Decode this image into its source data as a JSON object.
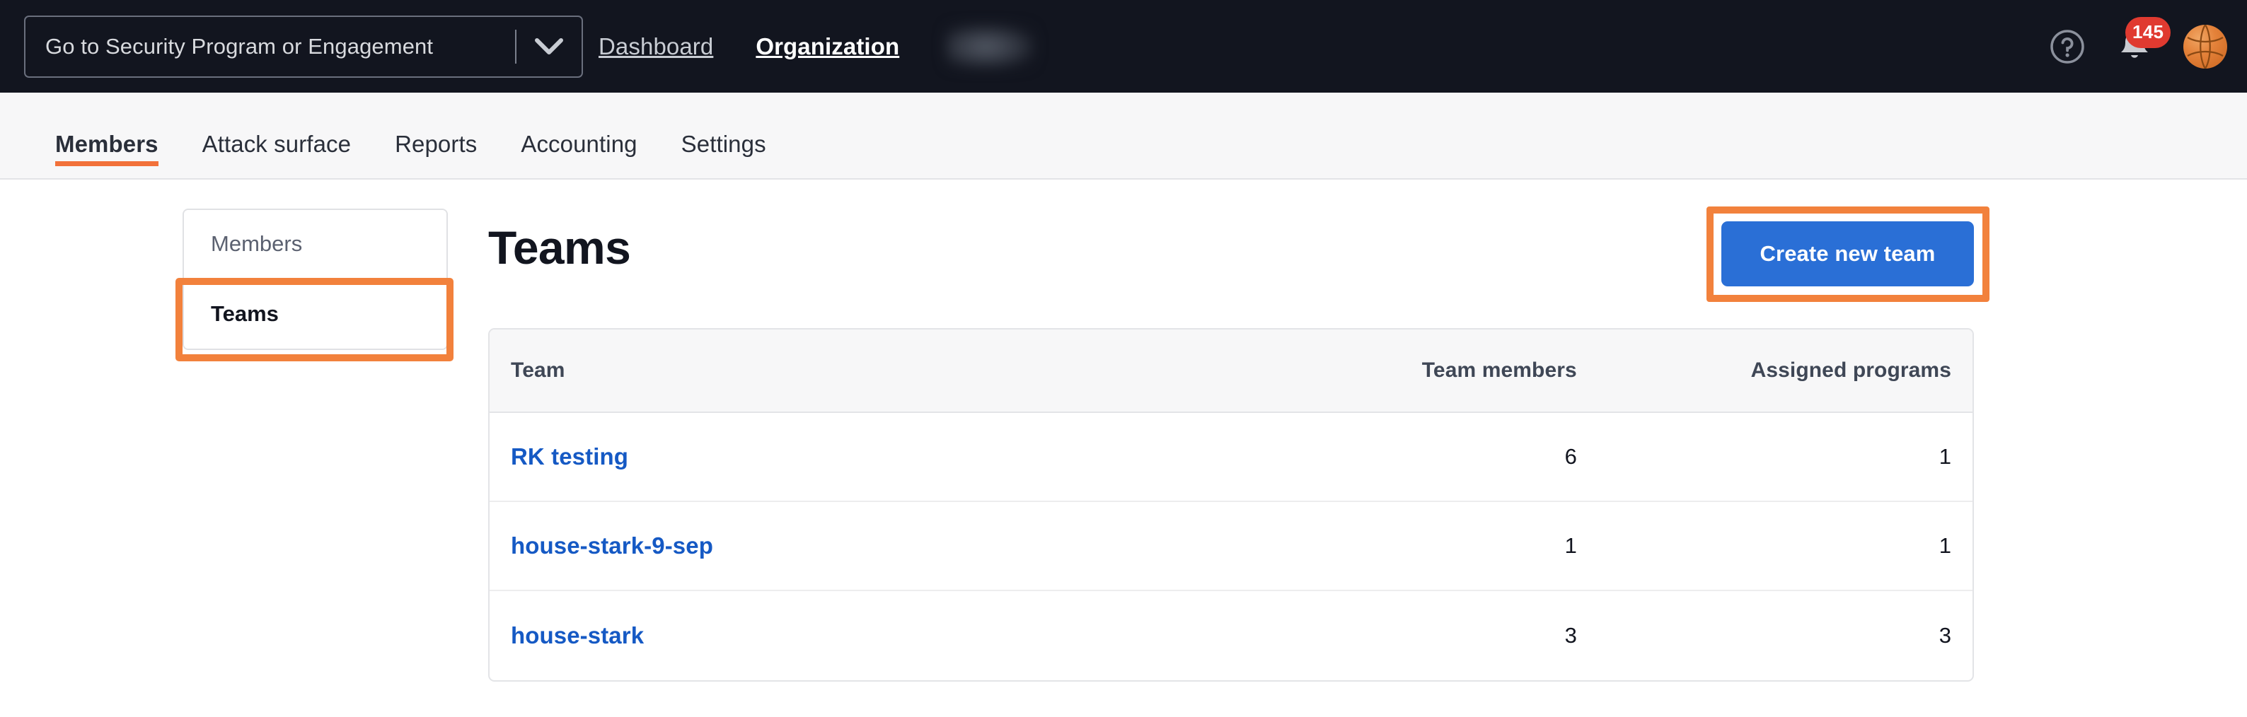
{
  "header": {
    "program_selector": {
      "value": "Go to Security Program or Engagement",
      "chevron_icon": "chevron-down-icon"
    },
    "nav": [
      {
        "label": "Dashboard",
        "active": false
      },
      {
        "label": "Organization",
        "active": true
      }
    ],
    "redacted_label": "",
    "help_icon": "question-circle-icon",
    "notifications": {
      "icon": "bell-icon",
      "badge_count": "145",
      "badge_color": "#e03a30"
    },
    "avatar_icon": "basketball-avatar"
  },
  "tabs": [
    {
      "label": "Members",
      "active": true
    },
    {
      "label": "Attack surface",
      "active": false
    },
    {
      "label": "Reports",
      "active": false
    },
    {
      "label": "Accounting",
      "active": false
    },
    {
      "label": "Settings",
      "active": false
    }
  ],
  "sidebar": {
    "items": [
      {
        "label": "Members",
        "selected": false
      },
      {
        "label": "Teams",
        "selected": true
      }
    ]
  },
  "main": {
    "title": "Teams",
    "create_button_label": "Create new team",
    "table": {
      "columns": [
        "Team",
        "Team members",
        "Assigned programs"
      ],
      "rows": [
        {
          "team": "RK testing",
          "members": "6",
          "programs": "1"
        },
        {
          "team": "house-stark-9-sep",
          "members": "1",
          "programs": "1"
        },
        {
          "team": "house-stark",
          "members": "3",
          "programs": "3"
        }
      ]
    }
  },
  "colors": {
    "header_bg": "#12151f",
    "tabstrip_bg": "#f7f7f8",
    "accent_orange": "#f2713a",
    "annotation_orange": "#f2813c",
    "primary_blue": "#2a6fd6",
    "link_blue": "#1559c4",
    "badge_red": "#e03a30"
  }
}
